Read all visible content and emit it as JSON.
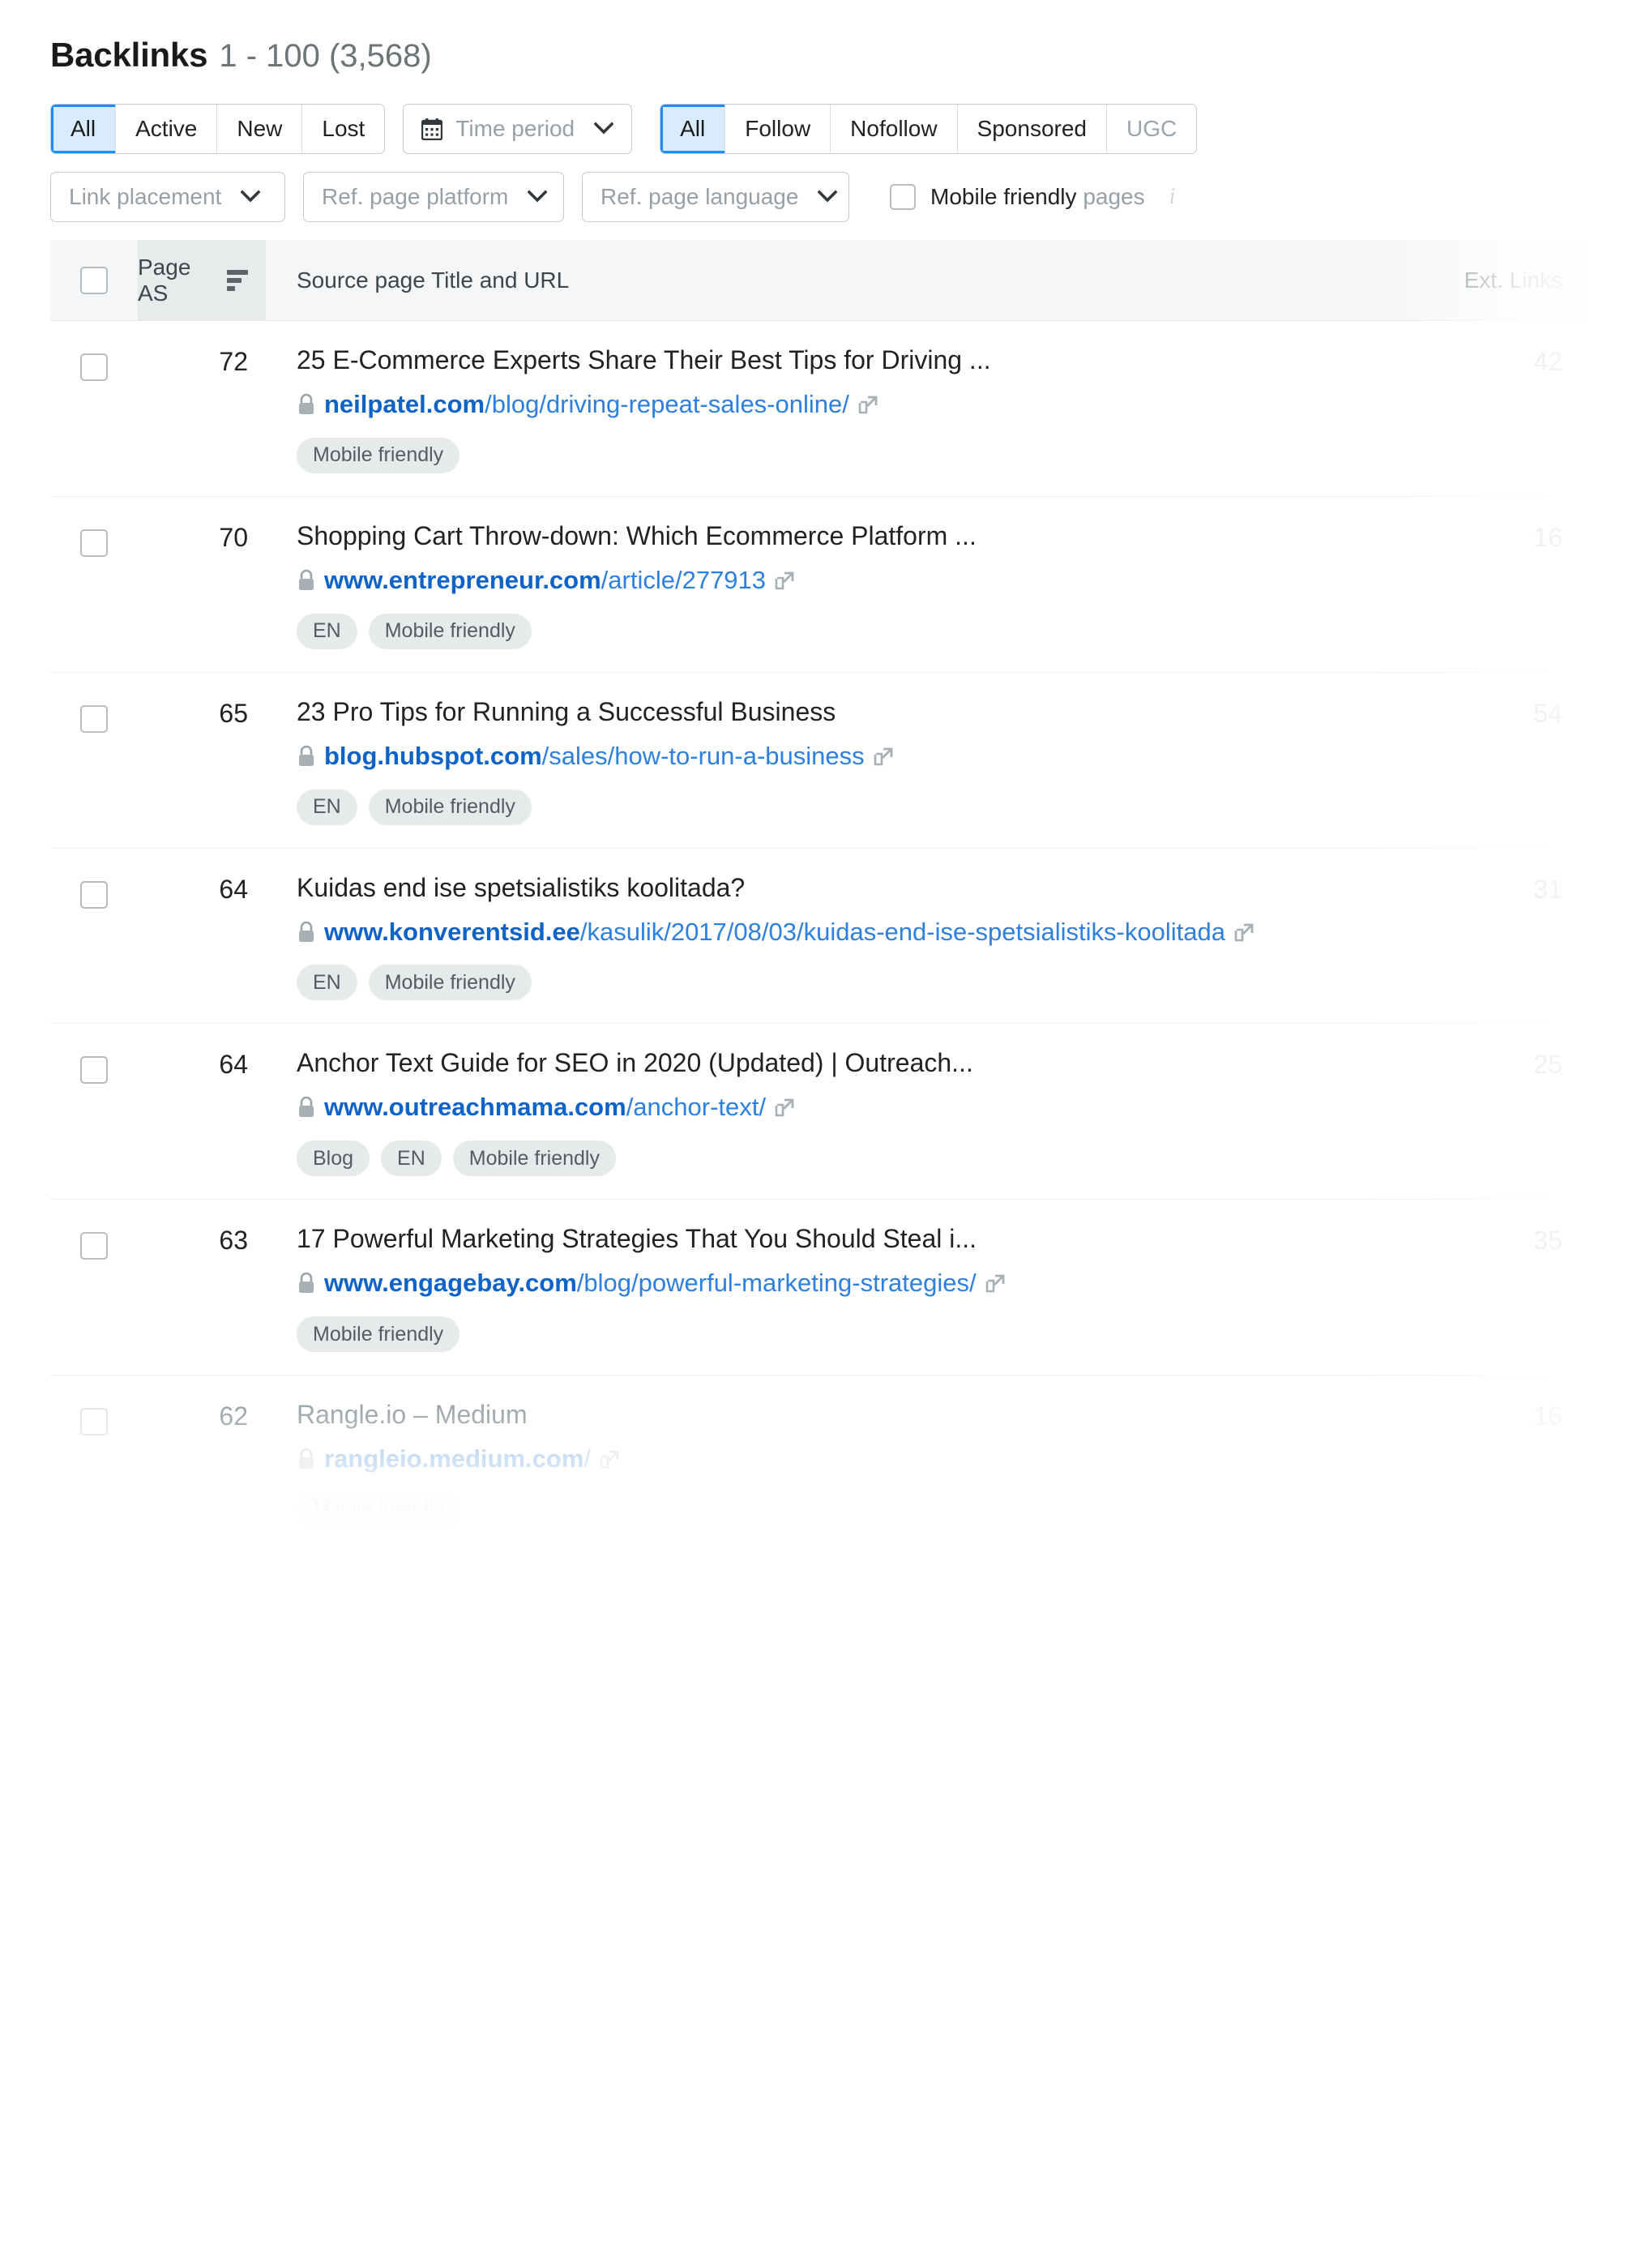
{
  "header": {
    "title": "Backlinks",
    "range": "1 - 100 (3,568)"
  },
  "filters": {
    "status_segment": [
      {
        "label": "All",
        "selected": true
      },
      {
        "label": "Active",
        "selected": false
      },
      {
        "label": "New",
        "selected": false
      },
      {
        "label": "Lost",
        "selected": false
      }
    ],
    "time_period": {
      "label": "Time period",
      "icon": "calendar-icon"
    },
    "follow_segment": [
      {
        "label": "All",
        "selected": true,
        "disabled": false
      },
      {
        "label": "Follow",
        "selected": false,
        "disabled": false
      },
      {
        "label": "Nofollow",
        "selected": false,
        "disabled": false
      },
      {
        "label": "Sponsored",
        "selected": false,
        "disabled": false
      },
      {
        "label": "UGC",
        "selected": false,
        "disabled": true
      }
    ],
    "link_placement": "Link placement",
    "ref_page_platform": "Ref. page platform",
    "ref_page_language": "Ref. page language",
    "mobile_friendly": {
      "label_strong": "Mobile friendly",
      "label_muted": "pages",
      "checked": false,
      "info_glyph": "i"
    }
  },
  "table": {
    "columns": {
      "select_all": "",
      "page_as": "Page AS",
      "source": "Source page Title and URL",
      "ext_links": "Ext. Links"
    },
    "sort": {
      "column": "Page AS",
      "direction": "desc",
      "icon": "sort-desc-icon"
    },
    "rows": [
      {
        "page_as": "72",
        "title": "25 E-Commerce Experts Share Their Best Tips for Driving ...",
        "url_domain": "neilpatel.com",
        "url_path": "/blog/driving-repeat-sales-online/",
        "badges": [
          "Mobile friendly"
        ],
        "ext_links": "42",
        "faded": false
      },
      {
        "page_as": "70",
        "title": "Shopping Cart Throw-down: Which Ecommerce Platform ...",
        "url_domain": "www.entrepreneur.com",
        "url_path": "/article/277913",
        "badges": [
          "EN",
          "Mobile friendly"
        ],
        "ext_links": "16",
        "faded": false
      },
      {
        "page_as": "65",
        "title": "23 Pro Tips for Running a Successful Business",
        "url_domain": "blog.hubspot.com",
        "url_path": "/sales/how-to-run-a-business",
        "badges": [
          "EN",
          "Mobile friendly"
        ],
        "ext_links": "54",
        "faded": false
      },
      {
        "page_as": "64",
        "title": "Kuidas end ise spetsialistiks koolitada?",
        "url_domain": "www.konverentsid.ee",
        "url_path": "/kasulik/2017/08/03/kuidas-end-ise-spetsialistiks-koolitada",
        "badges": [
          "EN",
          "Mobile friendly"
        ],
        "ext_links": "31",
        "faded": false
      },
      {
        "page_as": "64",
        "title": "Anchor Text Guide for SEO in 2020 (Updated) | Outreach...",
        "url_domain": "www.outreachmama.com",
        "url_path": "/anchor-text/",
        "badges": [
          "Blog",
          "EN",
          "Mobile friendly"
        ],
        "ext_links": "25",
        "faded": false
      },
      {
        "page_as": "63",
        "title": "17 Powerful Marketing Strategies That You Should Steal i...",
        "url_domain": "www.engagebay.com",
        "url_path": "/blog/powerful-marketing-strategies/",
        "badges": [
          "Mobile friendly"
        ],
        "ext_links": "35",
        "faded": false
      },
      {
        "page_as": "62",
        "title": "Rangle.io – Medium",
        "url_domain": "rangleio.medium.com",
        "url_path": "/",
        "badges": [
          "Mobile friendly"
        ],
        "ext_links": "16",
        "faded": true
      }
    ]
  },
  "colors": {
    "accent_blue": "#1a8cff",
    "selected_bg": "#d9ecfd",
    "link_domain": "#0e63c8",
    "link_path": "#2d7fe0",
    "badge_bg": "#e6eaeb",
    "header_bg": "#f4f6f7",
    "sorted_col_bg": "#e7ebec"
  }
}
